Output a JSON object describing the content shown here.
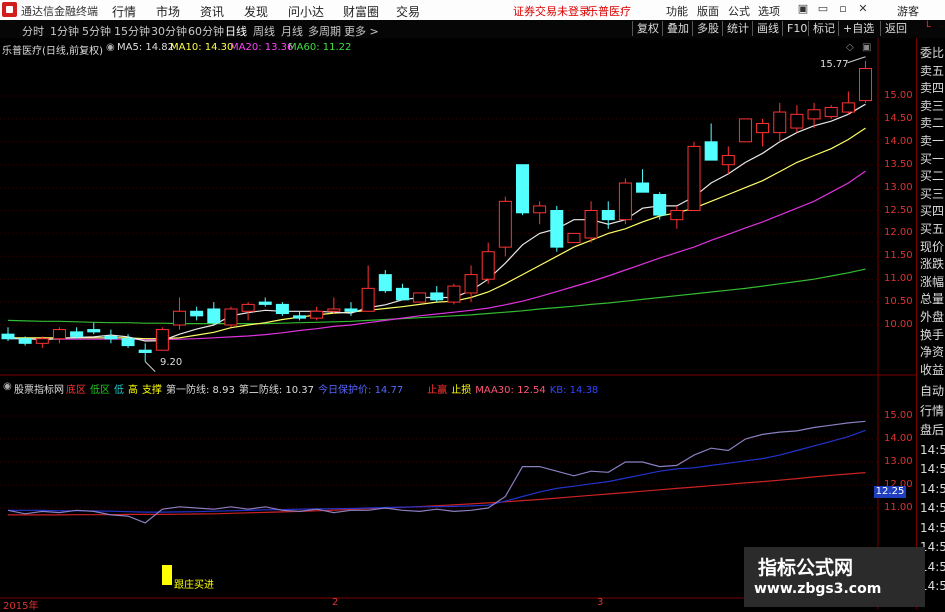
{
  "app": {
    "title": "通达信金融终端"
  },
  "menu": [
    "行情",
    "市场",
    "资讯",
    "发现",
    "问小达",
    "财富圈",
    "交易"
  ],
  "status": {
    "warning": "证券交易未登录",
    "stock_name": "乐普医疗"
  },
  "right_menu": [
    "功能",
    "版面",
    "公式",
    "选项"
  ],
  "guest_label": "游客",
  "periods": [
    "分时",
    "1分钟",
    "5分钟",
    "15分钟",
    "30分钟",
    "60分钟",
    "日线",
    "周线",
    "月线",
    "多周期",
    "更多 >"
  ],
  "active_period": "日线",
  "toolbar": [
    "复权",
    "叠加",
    "多股",
    "统计",
    "画线",
    "F10",
    "标记",
    "+自选",
    "返回"
  ],
  "chart": {
    "title": "乐普医疗(日线,前复权)",
    "ma5": "MA5: 14.82",
    "ma10": "MA10: 14.30",
    "ma20": "MA20: 13.36",
    "ma60": "MA60: 11.22",
    "high_label": "15.77",
    "low_label": "9.20",
    "price_ticks": [
      "15.00",
      "14.50",
      "14.00",
      "13.50",
      "13.00",
      "12.50",
      "12.00",
      "11.50",
      "11.00",
      "10.50",
      "10.00"
    ]
  },
  "indicator": {
    "name": "股票指标网",
    "items": [
      {
        "text": "底区",
        "color": "#ff3333"
      },
      {
        "text": "低区",
        "color": "#22cc22"
      },
      {
        "text": "低",
        "color": "#22cccc"
      },
      {
        "text": "高",
        "color": "#ffff00"
      },
      {
        "text": "支撑",
        "color": "#ffff00"
      },
      {
        "text": "第一防线: 8.93",
        "color": "#dddddd"
      },
      {
        "text": "第二防线: 10.37",
        "color": "#dddddd"
      },
      {
        "text": "今日保护价: 14.77",
        "color": "#5566ff"
      },
      {
        "text": "止赢",
        "color": "#ff3333"
      },
      {
        "text": "止损",
        "color": "#ffff00"
      },
      {
        "text": "MAA30: 12.54",
        "color": "#ff5577"
      },
      {
        "text": "KB: 14.38",
        "color": "#3344ff"
      }
    ],
    "ticks": [
      "15.00",
      "14.00",
      "13.00",
      "12.00",
      "11.00"
    ],
    "current_value": "12.25",
    "buy_signal": "跟庄买进"
  },
  "right_panel": [
    "委比",
    "卖五",
    "卖四",
    "卖三",
    "卖二",
    "卖一",
    "买一",
    "买二",
    "买三",
    "买四",
    "买五",
    "现价",
    "涨跌",
    "涨幅",
    "总量",
    "外盘",
    "换手",
    "净资",
    "收益"
  ],
  "right_panel_lower": [
    "自动",
    "行情",
    "盘后",
    "14:5",
    "14:5",
    "14:5",
    "14:5",
    "14:5",
    "14:5",
    "14:5",
    "14:5"
  ],
  "time_axis": [
    "2015年",
    "2",
    "3"
  ],
  "watermark": {
    "title": "指标公式网",
    "url": "www.zbgs3.com"
  },
  "chart_data": {
    "type": "candlestick",
    "candles": [
      {
        "o": 9.8,
        "h": 9.95,
        "l": 9.65,
        "c": 9.7
      },
      {
        "o": 9.7,
        "h": 9.75,
        "l": 9.55,
        "c": 9.6
      },
      {
        "o": 9.6,
        "h": 9.75,
        "l": 9.5,
        "c": 9.7
      },
      {
        "o": 9.7,
        "h": 9.95,
        "l": 9.6,
        "c": 9.9
      },
      {
        "o": 9.85,
        "h": 9.95,
        "l": 9.7,
        "c": 9.75
      },
      {
        "o": 9.9,
        "h": 10.05,
        "l": 9.8,
        "c": 9.85
      },
      {
        "o": 9.75,
        "h": 9.9,
        "l": 9.6,
        "c": 9.7
      },
      {
        "o": 9.7,
        "h": 9.8,
        "l": 9.5,
        "c": 9.55
      },
      {
        "o": 9.45,
        "h": 9.6,
        "l": 9.2,
        "c": 9.4
      },
      {
        "o": 9.45,
        "h": 9.95,
        "l": 9.45,
        "c": 9.9
      },
      {
        "o": 10.0,
        "h": 10.6,
        "l": 9.9,
        "c": 10.3
      },
      {
        "o": 10.3,
        "h": 10.4,
        "l": 10.1,
        "c": 10.2
      },
      {
        "o": 10.35,
        "h": 10.5,
        "l": 10.0,
        "c": 10.05
      },
      {
        "o": 10.0,
        "h": 10.4,
        "l": 9.95,
        "c": 10.35
      },
      {
        "o": 10.3,
        "h": 10.5,
        "l": 10.1,
        "c": 10.45
      },
      {
        "o": 10.5,
        "h": 10.6,
        "l": 10.4,
        "c": 10.45
      },
      {
        "o": 10.45,
        "h": 10.5,
        "l": 10.2,
        "c": 10.25
      },
      {
        "o": 10.2,
        "h": 10.3,
        "l": 10.1,
        "c": 10.15
      },
      {
        "o": 10.15,
        "h": 10.4,
        "l": 10.1,
        "c": 10.3
      },
      {
        "o": 10.3,
        "h": 10.6,
        "l": 10.25,
        "c": 10.35
      },
      {
        "o": 10.35,
        "h": 10.5,
        "l": 10.2,
        "c": 10.3
      },
      {
        "o": 10.3,
        "h": 11.3,
        "l": 10.3,
        "c": 10.8
      },
      {
        "o": 11.1,
        "h": 11.2,
        "l": 10.7,
        "c": 10.75
      },
      {
        "o": 10.8,
        "h": 10.9,
        "l": 10.6,
        "c": 10.55
      },
      {
        "o": 10.5,
        "h": 10.7,
        "l": 10.5,
        "c": 10.7
      },
      {
        "o": 10.7,
        "h": 10.85,
        "l": 10.5,
        "c": 10.55
      },
      {
        "o": 10.5,
        "h": 10.9,
        "l": 10.45,
        "c": 10.85
      },
      {
        "o": 10.7,
        "h": 11.3,
        "l": 10.5,
        "c": 11.1
      },
      {
        "o": 11.0,
        "h": 11.8,
        "l": 10.9,
        "c": 11.6
      },
      {
        "o": 11.7,
        "h": 12.8,
        "l": 11.5,
        "c": 12.7
      },
      {
        "o": 13.5,
        "h": 13.5,
        "l": 12.4,
        "c": 12.45
      },
      {
        "o": 12.45,
        "h": 12.7,
        "l": 12.2,
        "c": 12.6
      },
      {
        "o": 12.5,
        "h": 12.6,
        "l": 11.6,
        "c": 11.7
      },
      {
        "o": 11.8,
        "h": 12.0,
        "l": 11.8,
        "c": 12.0
      },
      {
        "o": 11.9,
        "h": 12.7,
        "l": 11.8,
        "c": 12.5
      },
      {
        "o": 12.5,
        "h": 12.7,
        "l": 12.1,
        "c": 12.3
      },
      {
        "o": 12.3,
        "h": 13.2,
        "l": 12.2,
        "c": 13.1
      },
      {
        "o": 13.1,
        "h": 13.4,
        "l": 12.9,
        "c": 12.9
      },
      {
        "o": 12.85,
        "h": 12.9,
        "l": 12.3,
        "c": 12.4
      },
      {
        "o": 12.3,
        "h": 12.6,
        "l": 12.1,
        "c": 12.5
      },
      {
        "o": 12.5,
        "h": 14.0,
        "l": 12.5,
        "c": 13.9
      },
      {
        "o": 14.0,
        "h": 14.4,
        "l": 13.6,
        "c": 13.6
      },
      {
        "o": 13.5,
        "h": 13.9,
        "l": 13.3,
        "c": 13.7
      },
      {
        "o": 14.0,
        "h": 14.5,
        "l": 14.0,
        "c": 14.5
      },
      {
        "o": 14.2,
        "h": 14.5,
        "l": 13.9,
        "c": 14.4
      },
      {
        "o": 14.2,
        "h": 14.85,
        "l": 14.0,
        "c": 14.65
      },
      {
        "o": 14.3,
        "h": 14.8,
        "l": 14.2,
        "c": 14.6
      },
      {
        "o": 14.5,
        "h": 14.85,
        "l": 14.3,
        "c": 14.7
      },
      {
        "o": 14.55,
        "h": 14.8,
        "l": 14.5,
        "c": 14.75
      },
      {
        "o": 14.65,
        "h": 15.1,
        "l": 14.6,
        "c": 14.85
      },
      {
        "o": 14.9,
        "h": 15.77,
        "l": 14.85,
        "c": 15.6
      }
    ],
    "ma5": [
      9.7,
      9.7,
      9.68,
      9.7,
      9.73,
      9.74,
      9.78,
      9.74,
      9.65,
      9.66,
      9.8,
      9.91,
      10.0,
      10.2,
      10.27,
      10.32,
      10.3,
      10.3,
      10.3,
      10.28,
      10.26,
      10.38,
      10.44,
      10.55,
      10.6,
      10.6,
      10.6,
      10.75,
      11.0,
      11.35,
      11.75,
      12.0,
      12.1,
      12.3,
      12.3,
      12.2,
      12.3,
      12.55,
      12.6,
      12.6,
      12.8,
      13.1,
      13.3,
      13.55,
      13.75,
      14.0,
      14.2,
      14.35,
      14.45,
      14.6,
      14.82
    ],
    "ma10": [
      9.72,
      9.72,
      9.72,
      9.72,
      9.72,
      9.72,
      9.72,
      9.72,
      9.7,
      9.7,
      9.72,
      9.78,
      9.84,
      9.94,
      10.0,
      10.05,
      10.12,
      10.17,
      10.22,
      10.26,
      10.28,
      10.32,
      10.36,
      10.4,
      10.45,
      10.5,
      10.52,
      10.6,
      10.72,
      10.9,
      11.1,
      11.3,
      11.5,
      11.7,
      11.85,
      12.0,
      12.1,
      12.25,
      12.38,
      12.45,
      12.55,
      12.7,
      12.85,
      13.0,
      13.15,
      13.35,
      13.55,
      13.7,
      13.85,
      14.05,
      14.3
    ],
    "ma20": [
      9.7,
      9.7,
      9.7,
      9.69,
      9.69,
      9.69,
      9.69,
      9.69,
      9.68,
      9.68,
      9.69,
      9.7,
      9.72,
      9.74,
      9.76,
      9.79,
      9.83,
      9.88,
      9.92,
      9.97,
      10.0,
      10.05,
      10.1,
      10.15,
      10.2,
      10.24,
      10.28,
      10.32,
      10.37,
      10.44,
      10.52,
      10.62,
      10.73,
      10.84,
      10.95,
      11.07,
      11.2,
      11.33,
      11.46,
      11.58,
      11.7,
      11.85,
      11.98,
      12.12,
      12.25,
      12.4,
      12.55,
      12.7,
      12.9,
      13.1,
      13.36
    ],
    "ma60": [
      10.1,
      10.09,
      10.08,
      10.08,
      10.07,
      10.06,
      10.05,
      10.05,
      10.04,
      10.04,
      10.03,
      10.03,
      10.03,
      10.03,
      10.03,
      10.03,
      10.04,
      10.05,
      10.06,
      10.07,
      10.08,
      10.1,
      10.12,
      10.14,
      10.16,
      10.18,
      10.2,
      10.22,
      10.25,
      10.28,
      10.31,
      10.35,
      10.38,
      10.41,
      10.45,
      10.48,
      10.52,
      10.56,
      10.6,
      10.64,
      10.68,
      10.72,
      10.76,
      10.8,
      10.85,
      10.9,
      10.95,
      11.0,
      11.07,
      11.14,
      11.22
    ],
    "ind_purple": [
      10.9,
      10.75,
      10.85,
      10.8,
      10.9,
      10.85,
      10.7,
      10.65,
      10.35,
      10.95,
      11.05,
      11.0,
      10.95,
      11.05,
      10.95,
      11.05,
      10.9,
      10.85,
      10.95,
      10.8,
      10.9,
      10.9,
      11.0,
      10.9,
      10.85,
      10.95,
      10.85,
      10.9,
      11.0,
      11.5,
      12.8,
      12.8,
      12.6,
      12.4,
      12.6,
      12.55,
      13.0,
      13.0,
      12.8,
      12.85,
      13.3,
      13.6,
      13.5,
      14.0,
      14.2,
      14.3,
      14.35,
      14.5,
      14.6,
      14.7,
      14.77
    ],
    "ind_blue": [
      10.9,
      10.9,
      10.9,
      10.88,
      10.88,
      10.87,
      10.86,
      10.84,
      10.82,
      10.82,
      10.83,
      10.84,
      10.86,
      10.88,
      10.9,
      10.92,
      10.93,
      10.95,
      10.96,
      10.97,
      10.98,
      11.0,
      11.02,
      11.04,
      11.05,
      11.06,
      11.07,
      11.09,
      11.12,
      11.3,
      11.5,
      11.7,
      11.85,
      11.95,
      12.05,
      12.15,
      12.3,
      12.45,
      12.6,
      12.7,
      12.75,
      12.85,
      12.95,
      13.05,
      13.15,
      13.3,
      13.5,
      13.7,
      13.9,
      14.1,
      14.38
    ],
    "ind_red": [
      10.7,
      10.7,
      10.7,
      10.7,
      10.71,
      10.71,
      10.71,
      10.72,
      10.72,
      10.72,
      10.73,
      10.74,
      10.75,
      10.77,
      10.79,
      10.81,
      10.83,
      10.85,
      10.88,
      10.91,
      10.94,
      10.97,
      11.0,
      11.03,
      11.06,
      11.1,
      11.14,
      11.18,
      11.22,
      11.27,
      11.32,
      11.37,
      11.43,
      11.49,
      11.55,
      11.61,
      11.67,
      11.73,
      11.79,
      11.85,
      11.91,
      11.97,
      12.03,
      12.09,
      12.15,
      12.21,
      12.28,
      12.35,
      12.42,
      12.48,
      12.54
    ]
  }
}
